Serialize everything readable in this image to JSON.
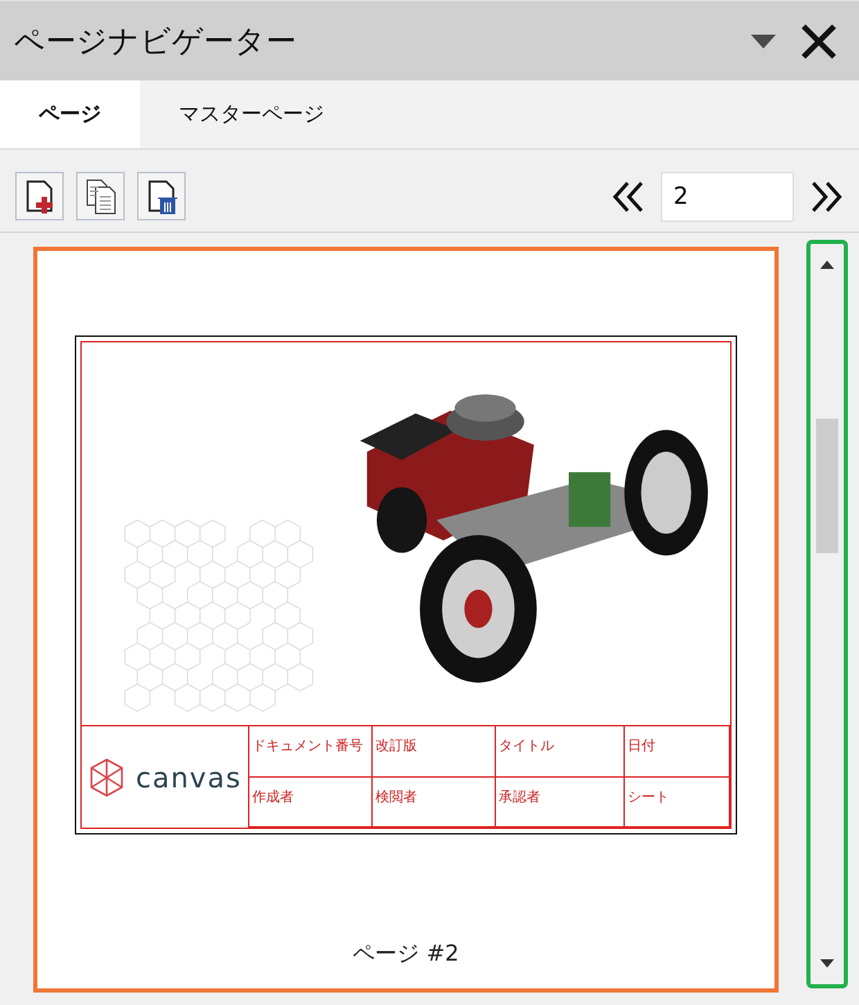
{
  "window": {
    "title": "ページナビゲーター"
  },
  "tabs": [
    {
      "label": "ページ",
      "selected": true
    },
    {
      "label": "マスターページ",
      "selected": false
    }
  ],
  "toolbar": {
    "buttons": [
      {
        "kind": "add"
      },
      {
        "kind": "copy"
      },
      {
        "kind": "delete"
      }
    ],
    "page_field": {
      "value": "2"
    }
  },
  "page": {
    "selected": true,
    "label": "ページ #2",
    "sheet": {
      "logo": "canvas",
      "title_block": [
        [
          "ドキュメント番号",
          "改訂版",
          "タイトル",
          "日付"
        ],
        [
          "作成者",
          "検閲者",
          "承認者",
          "シート"
        ]
      ]
    }
  }
}
